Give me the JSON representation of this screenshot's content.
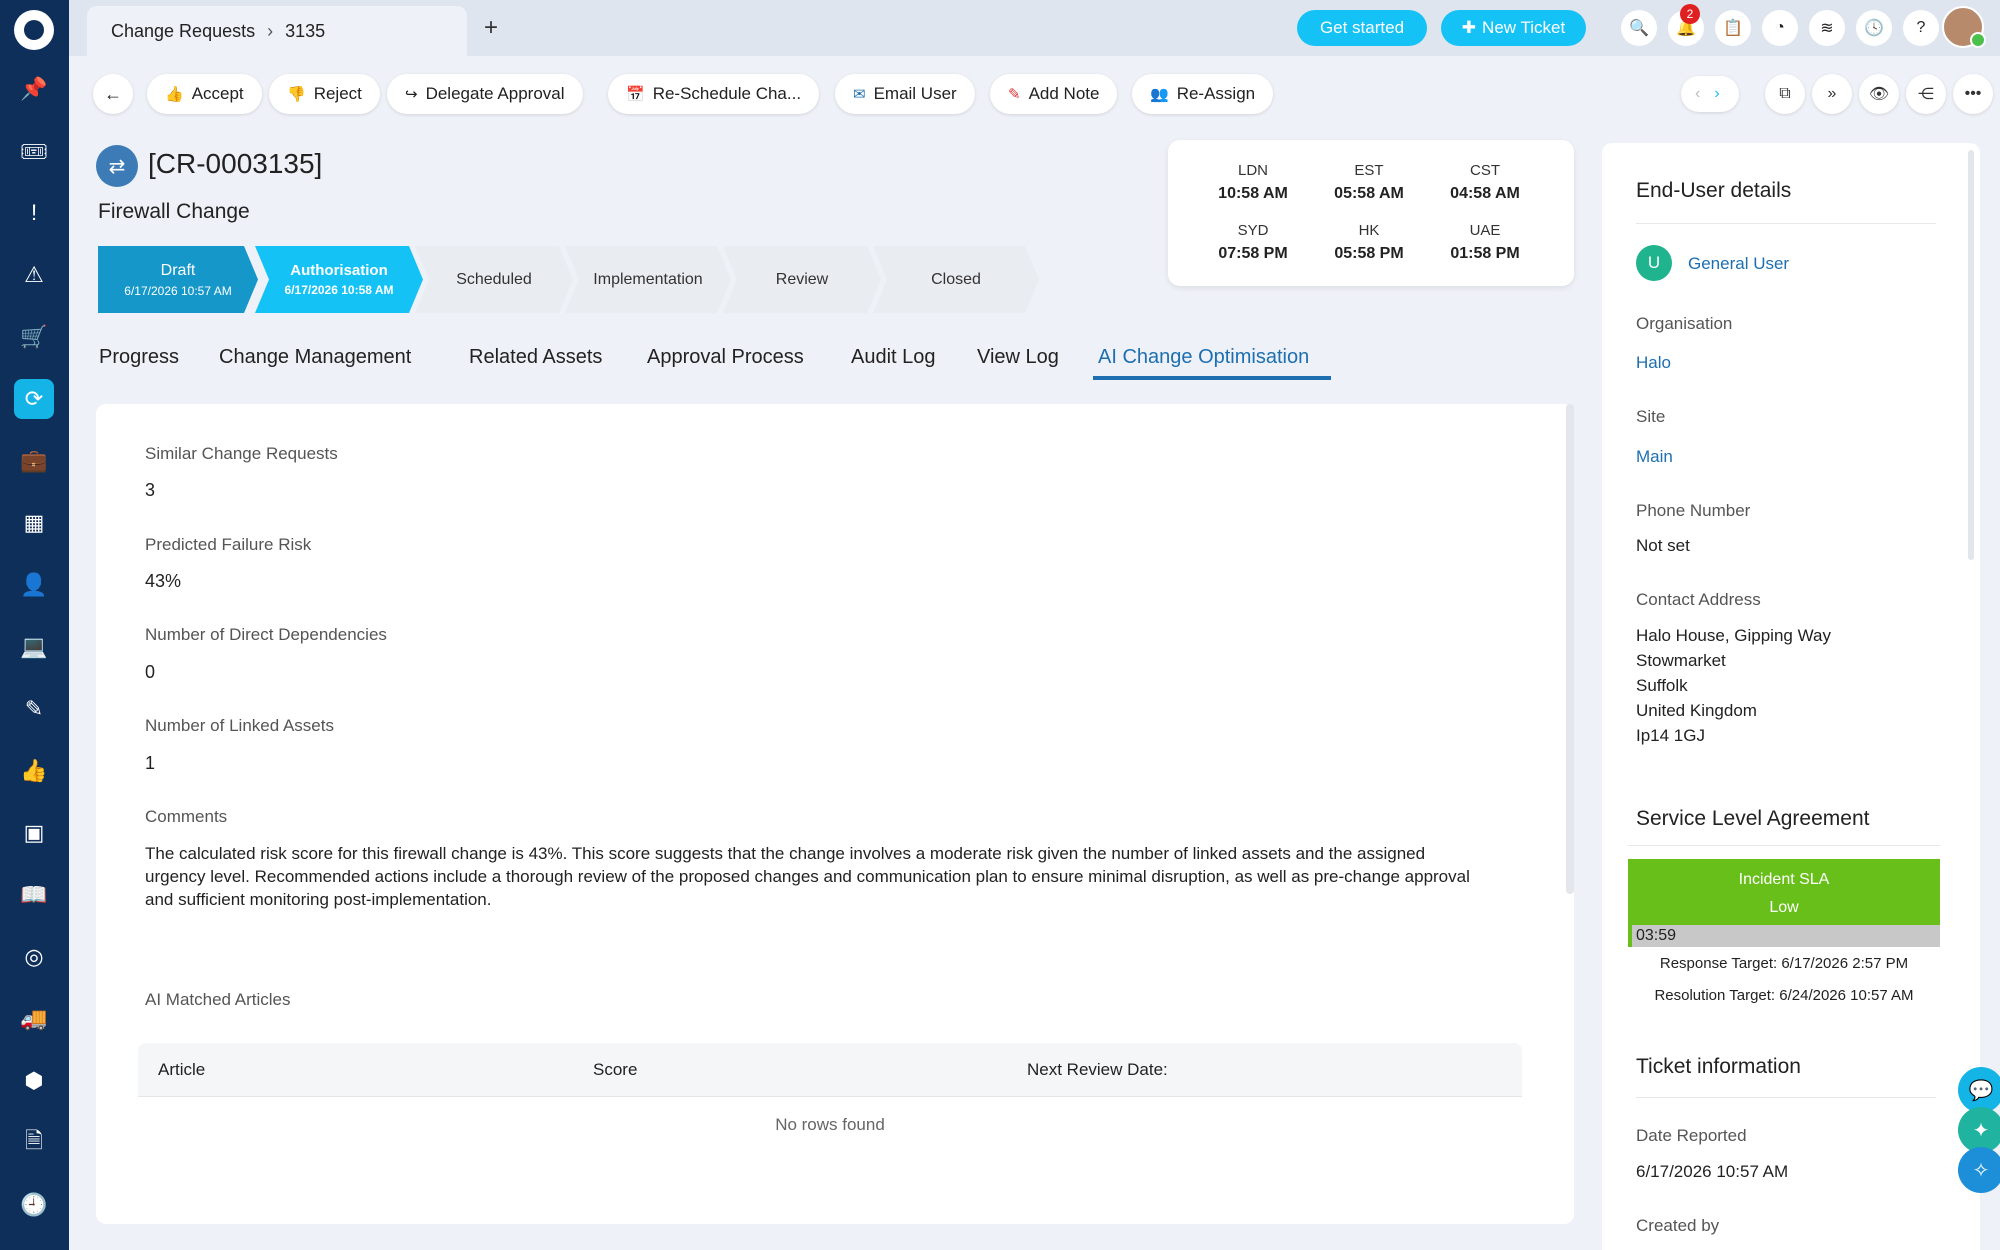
{
  "breadcrumb": {
    "section": "Change Requests",
    "id": "3135"
  },
  "topbar": {
    "get_started": "Get started",
    "new_ticket": "New Ticket",
    "notif_count": "2"
  },
  "actions": {
    "accept": "Accept",
    "reject": "Reject",
    "delegate": "Delegate Approval",
    "reschedule": "Re-Schedule Cha...",
    "email": "Email User",
    "note": "Add Note",
    "reassign": "Re-Assign"
  },
  "ticket": {
    "id": "[CR-0003135]",
    "title": "Firewall Change"
  },
  "stages": [
    {
      "name": "Draft",
      "date": "6/17/2026 10:57 AM"
    },
    {
      "name": "Authorisation",
      "date": "6/17/2026 10:58 AM"
    },
    {
      "name": "Scheduled",
      "date": ""
    },
    {
      "name": "Implementation",
      "date": ""
    },
    {
      "name": "Review",
      "date": ""
    },
    {
      "name": "Closed",
      "date": ""
    }
  ],
  "clocks": [
    {
      "zone": "LDN",
      "time": "10:58 AM"
    },
    {
      "zone": "EST",
      "time": "05:58 AM"
    },
    {
      "zone": "CST",
      "time": "04:58 AM"
    },
    {
      "zone": "SYD",
      "time": "07:58 PM"
    },
    {
      "zone": "HK",
      "time": "05:58 PM"
    },
    {
      "zone": "UAE",
      "time": "01:58 PM"
    }
  ],
  "tabs": [
    "Progress",
    "Change Management",
    "Related Assets",
    "Approval Process",
    "Audit Log",
    "View Log",
    "AI Change Optimisation"
  ],
  "main": {
    "similar_label": "Similar Change Requests",
    "similar_value": "3",
    "risk_label": "Predicted Failure Risk",
    "risk_value": "43%",
    "deps_label": "Number of Direct Dependencies",
    "deps_value": "0",
    "assets_label": "Number of Linked Assets",
    "assets_value": "1",
    "comments_label": "Comments",
    "comments_text": "The calculated risk score for this firewall change is 43%. This score suggests that the change involves a moderate risk given the number of linked assets and the assigned urgency level. Recommended actions include a thorough review of the proposed changes and communication plan to ensure minimal disruption, as well as pre-change approval and sufficient monitoring post-implementation.",
    "articles_label": "AI Matched Articles",
    "grid_columns": [
      "Article",
      "Score",
      "Next Review Date:"
    ],
    "grid_empty": "No rows found"
  },
  "enduser": {
    "heading": "End-User details",
    "avatar_letter": "U",
    "user": "General User",
    "org_label": "Organisation",
    "org": "Halo",
    "site_label": "Site",
    "site": "Main",
    "phone_label": "Phone Number",
    "phone": "Not set",
    "address_label": "Contact Address",
    "address": [
      "Halo House, Gipping Way",
      "Stowmarket",
      "Suffolk",
      "United Kingdom",
      "Ip14 1GJ"
    ]
  },
  "sla": {
    "heading": "Service Level Agreement",
    "name": "Incident SLA",
    "priority": "Low",
    "time": "03:59",
    "response": "Response Target: 6/17/2026 2:57 PM",
    "resolution": "Resolution Target: 6/24/2026 10:57 AM",
    "color": "#68bf1a"
  },
  "ticket_info": {
    "heading": "Ticket information",
    "date_label": "Date Reported",
    "date": "6/17/2026 10:57 AM",
    "created_by": "Created by"
  }
}
